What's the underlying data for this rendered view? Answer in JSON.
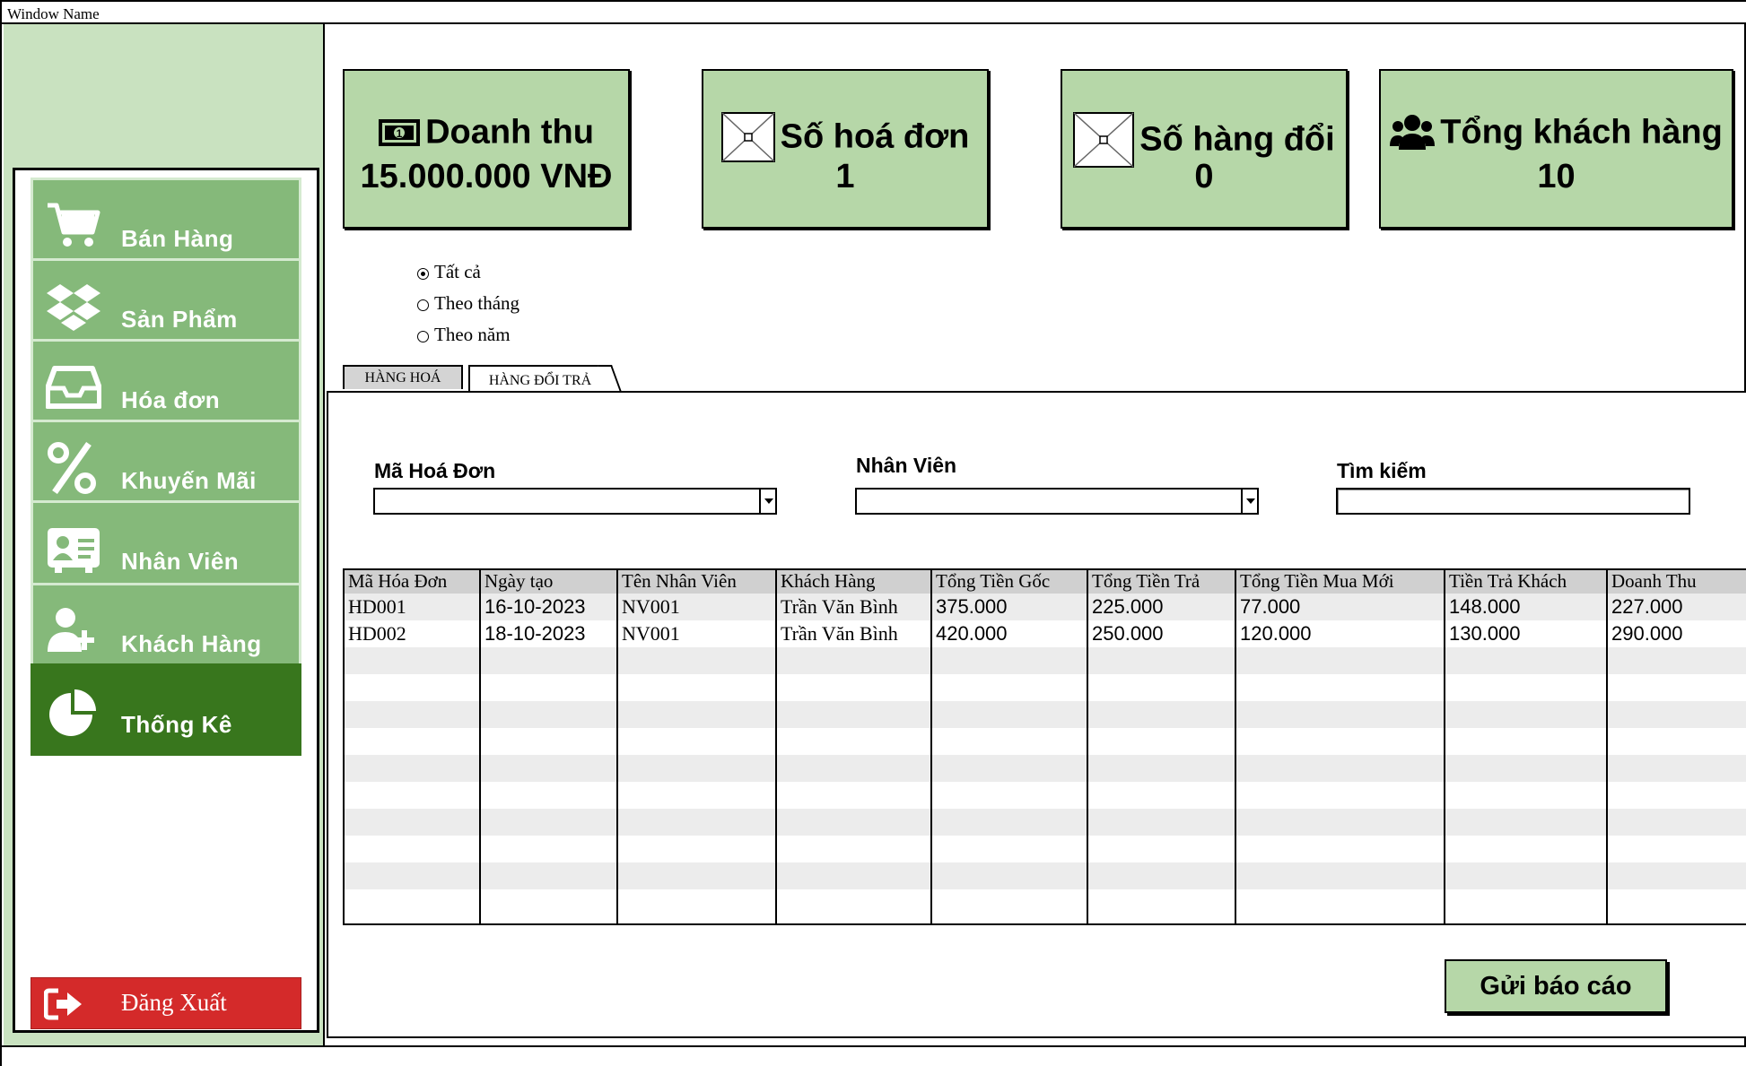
{
  "window": {
    "title": "Window Name"
  },
  "sidebar": {
    "items": [
      {
        "label": "Bán Hàng",
        "icon": "cart-icon"
      },
      {
        "label": "Sản Phẩm",
        "icon": "dropbox-icon"
      },
      {
        "label": "Hóa đơn",
        "icon": "inbox-icon"
      },
      {
        "label": "Khuyến Mãi",
        "icon": "percent-icon"
      },
      {
        "label": "Nhân Viên",
        "icon": "id-card-icon"
      },
      {
        "label": "Khách Hàng",
        "icon": "user-plus-icon"
      },
      {
        "label": "Thống Kê",
        "icon": "pie-chart-icon",
        "active": true
      }
    ],
    "logout_label": "Đăng Xuất",
    "active_color": "#38761d",
    "item_color": "#85b97a",
    "logout_color": "#d42a2a"
  },
  "stats": [
    {
      "title": "Doanh thu",
      "value": "15.000.000 VNĐ",
      "icon": "money-bill-icon"
    },
    {
      "title": "Số hoá đơn",
      "value": "1",
      "icon": "image-placeholder-icon"
    },
    {
      "title": "Số hàng đổi",
      "value": "0",
      "icon": "image-placeholder-icon"
    },
    {
      "title": "Tổng khách hàng",
      "value": "10",
      "icon": "users-icon"
    }
  ],
  "filter": {
    "options": [
      "Tất cả",
      "Theo tháng",
      "Theo năm"
    ],
    "selected": "Tất cả"
  },
  "tabs": [
    {
      "label": "HÀNG HOÁ",
      "active": false
    },
    {
      "label": "HÀNG ĐỔI TRẢ",
      "active": true
    }
  ],
  "form": {
    "invoice_label": "Mã Hoá Đơn",
    "invoice_value": "",
    "employee_label": "Nhân Viên",
    "employee_value": "",
    "search_label": "Tìm kiếm",
    "search_value": ""
  },
  "table": {
    "columns": [
      "Mã Hóa Đơn",
      "Ngày tạo",
      "Tên Nhân Viên",
      "Khách Hàng",
      "Tổng Tiền Gốc",
      "Tổng Tiền Trả",
      "Tổng Tiền Mua Mới",
      "Tiền Trả Khách",
      "Doanh Thu"
    ],
    "rows": [
      [
        "HD001",
        "16-10-2023",
        "NV001",
        "Trần Văn Bình",
        "375.000",
        "225.000",
        "77.000",
        "148.000",
        "227.000"
      ],
      [
        "HD002",
        "18-10-2023",
        "NV001",
        "Trần Văn Bình",
        "420.000",
        "250.000",
        "120.000",
        "130.000",
        "290.000"
      ]
    ]
  },
  "send_report_label": "Gửi báo cáo",
  "colors": {
    "card_bg": "#b6d7a8",
    "sidebar_bg": "#c9e2c0"
  }
}
